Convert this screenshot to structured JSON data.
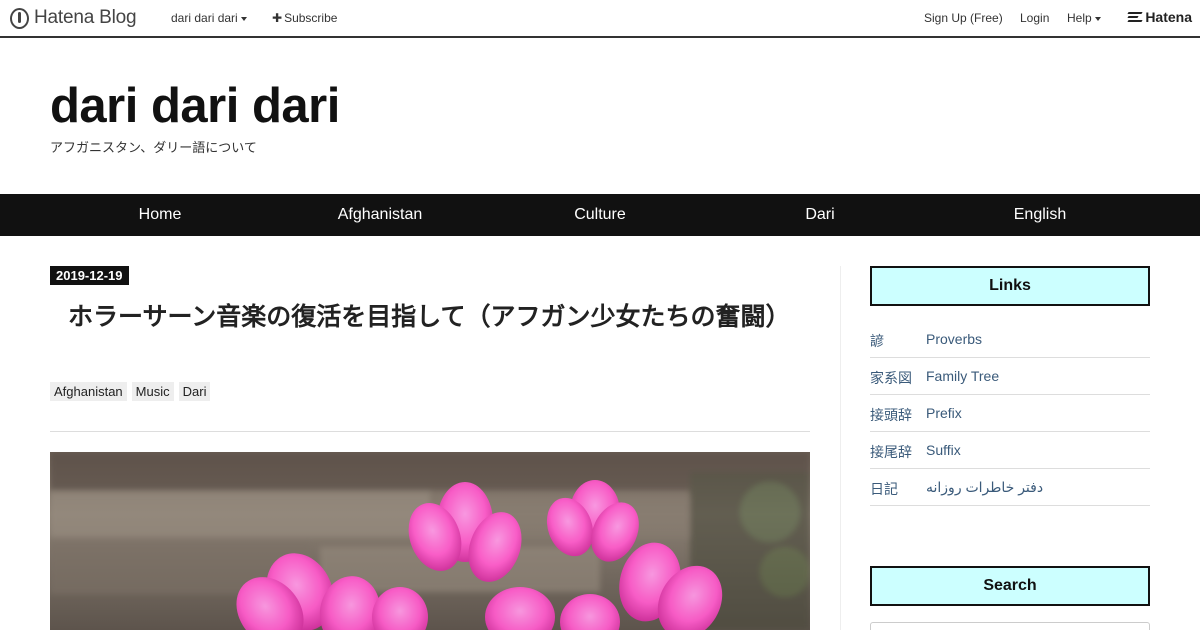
{
  "topbar": {
    "brand": "Hatena Blog",
    "blog_menu": "dari dari dari",
    "subscribe": "Subscribe",
    "signup": "Sign Up (Free)",
    "login": "Login",
    "help": "Help",
    "hatena": "Hatena"
  },
  "header": {
    "title": "dari dari dari",
    "description": "アフガニスタン、ダリー語について"
  },
  "nav": {
    "items": [
      "Home",
      "Afghanistan",
      "Culture",
      "Dari",
      "English"
    ]
  },
  "entry": {
    "date": "2019-12-19",
    "title": "ホラーサーン音楽の復活を目指して（アフガン少女たちの奮闘）",
    "categories": [
      "Afghanistan",
      "Music",
      "Dari"
    ]
  },
  "sidebar": {
    "links_heading": "Links",
    "links": [
      {
        "jp": "諺",
        "en": "Proverbs"
      },
      {
        "jp": "家系図",
        "en": "Family Tree"
      },
      {
        "jp": "接頭辞",
        "en": "Prefix"
      },
      {
        "jp": "接尾辞",
        "en": "Suffix"
      },
      {
        "jp": "日記",
        "en": "دفتر خاطرات روزانه"
      }
    ],
    "search_heading": "Search"
  },
  "colors": {
    "accent": "#ccffff",
    "nav_bg": "#111111",
    "link": "#3a5a7a"
  }
}
